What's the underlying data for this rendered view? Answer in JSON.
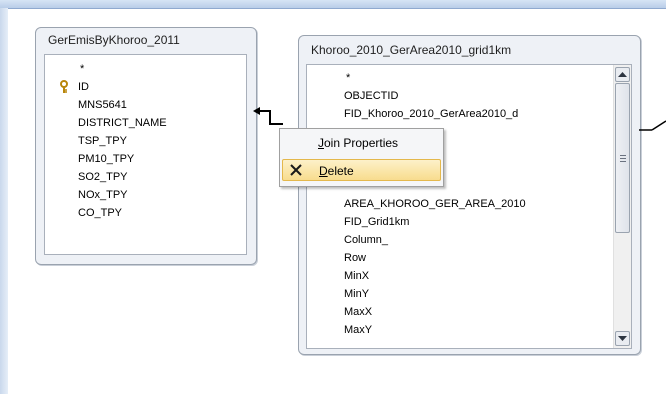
{
  "left_table": {
    "title": "GerEmisByKhoroo_2011",
    "fields": [
      "*",
      "ID",
      "MNS5641",
      "DISTRICT_NAME",
      "TSP_TPY",
      "PM10_TPY",
      "SO2_TPY",
      "NOx_TPY",
      "CO_TPY"
    ],
    "primary_key_icon": "key-icon"
  },
  "right_table": {
    "title": "Khoroo_2010_GerArea2010_grid1km",
    "fields": [
      "*",
      "OBJECTID",
      "FID_Khoroo_2010_GerArea2010_d",
      "",
      "",
      "",
      "",
      "AREA_KHOROO_GER_AREA_2010",
      "FID_Grid1km",
      "Column_",
      "Row",
      "MinX",
      "MinY",
      "MaxX",
      "MaxY"
    ],
    "scroll_up_icon": "scroll-up-arrow-icon",
    "scroll_down_icon": "scroll-down-arrow-icon"
  },
  "context_menu": {
    "items": [
      {
        "label_first": "J",
        "label_rest": "oin Properties"
      },
      {
        "label_first": "D",
        "label_rest": "elete",
        "icon": "delete-x-icon"
      }
    ]
  },
  "colors": {
    "menu_hover": "#f8dc8e",
    "table_background": "#eef1f6"
  }
}
